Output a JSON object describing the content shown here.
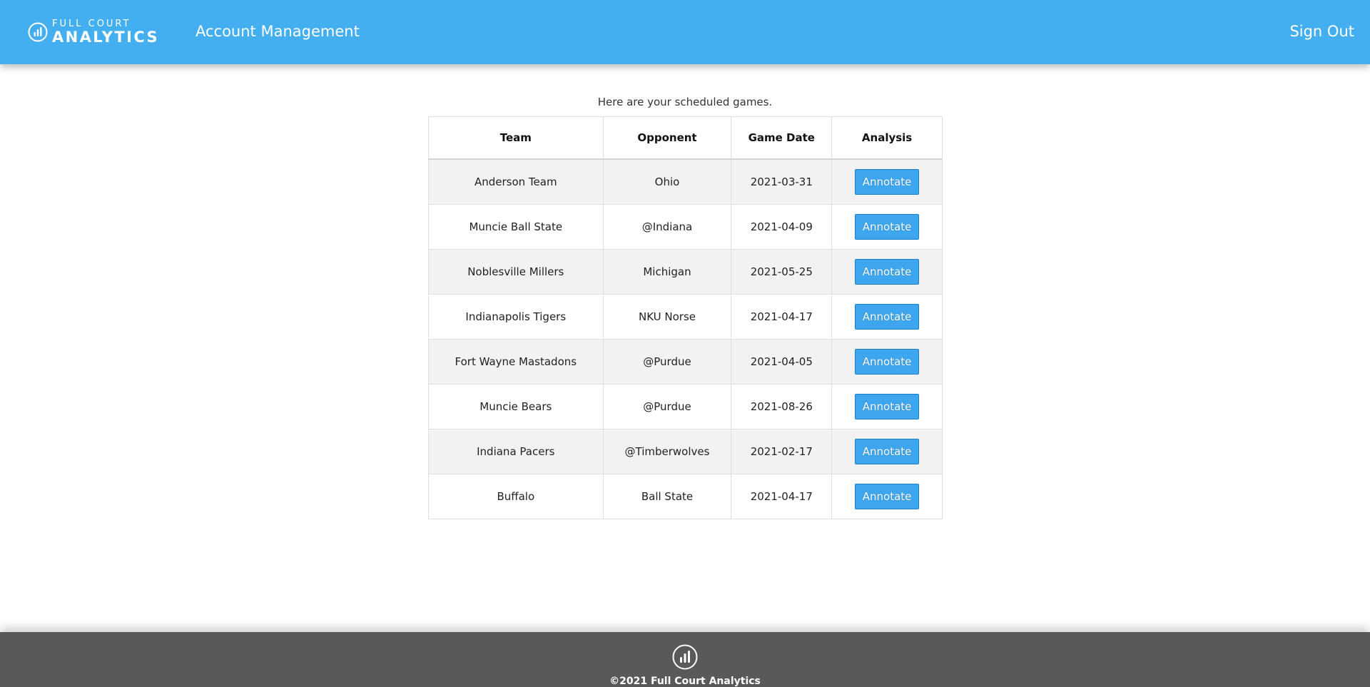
{
  "brand": {
    "line1": "FULL COURT",
    "line2": "ANALYTICS",
    "icon": "bar-chart-circle-icon"
  },
  "nav": {
    "title": "Account Management",
    "sign_out": "Sign Out"
  },
  "colors": {
    "header": "#44aff0",
    "button": "#3da6ee",
    "footer": "#595959",
    "row_stripe": "#f2f2f2"
  },
  "main": {
    "intro": "Here are your scheduled games.",
    "columns": [
      "Team",
      "Opponent",
      "Game Date",
      "Analysis"
    ],
    "rows": [
      {
        "team": "Anderson Team",
        "opponent": "Ohio",
        "date": "2021-03-31",
        "action": "Annotate"
      },
      {
        "team": "Muncie Ball State",
        "opponent": "@Indiana",
        "date": "2021-04-09",
        "action": "Annotate"
      },
      {
        "team": "Noblesville Millers",
        "opponent": "Michigan",
        "date": "2021-05-25",
        "action": "Annotate"
      },
      {
        "team": "Indianapolis Tigers",
        "opponent": "NKU Norse",
        "date": "2021-04-17",
        "action": "Annotate"
      },
      {
        "team": "Fort Wayne Mastadons",
        "opponent": "@Purdue",
        "date": "2021-04-05",
        "action": "Annotate"
      },
      {
        "team": "Muncie Bears",
        "opponent": "@Purdue",
        "date": "2021-08-26",
        "action": "Annotate"
      },
      {
        "team": "Indiana Pacers",
        "opponent": "@Timberwolves",
        "date": "2021-02-17",
        "action": "Annotate"
      },
      {
        "team": "Buffalo",
        "opponent": "Ball State",
        "date": "2021-04-17",
        "action": "Annotate"
      }
    ]
  },
  "footer": {
    "copyright": "©2021 Full Court Analytics",
    "icon": "bar-chart-circle-icon"
  }
}
